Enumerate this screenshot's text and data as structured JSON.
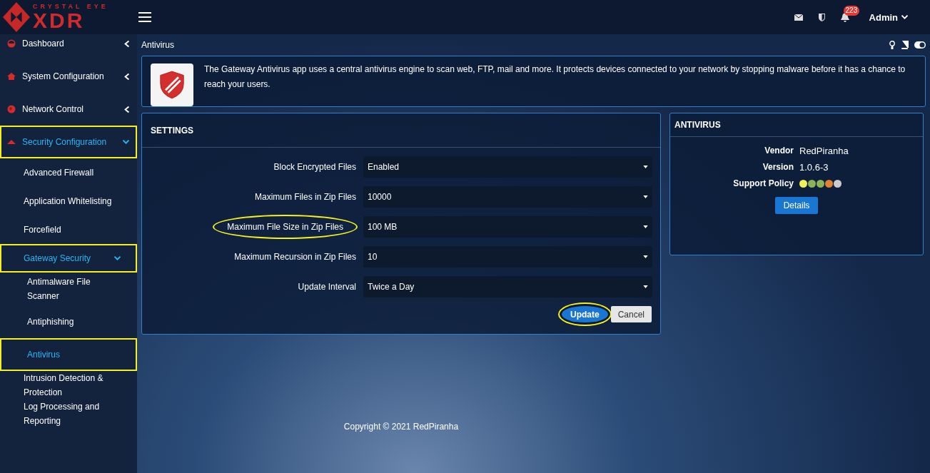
{
  "header": {
    "logo_small": "CRYSTAL EYE",
    "logo_big": "XDR",
    "notifications": "223",
    "user": "Admin"
  },
  "sidebar": {
    "items": [
      {
        "label": "Dashboard",
        "expanded": false,
        "selected": false,
        "highlighted": false
      },
      {
        "label": "System Configuration",
        "expanded": false,
        "selected": false,
        "highlighted": false
      },
      {
        "label": "Network Control",
        "expanded": false,
        "selected": false,
        "highlighted": false
      },
      {
        "label": "Security Configuration",
        "expanded": true,
        "selected": true,
        "highlighted": true,
        "children": [
          {
            "label": "Advanced Firewall",
            "selected": false,
            "highlighted": false
          },
          {
            "label": "Application Whitelisting",
            "selected": false,
            "highlighted": false
          },
          {
            "label": "Forcefield",
            "selected": false,
            "highlighted": false
          },
          {
            "label": "Gateway Security",
            "expanded": true,
            "selected": true,
            "highlighted": true,
            "children": [
              {
                "label": "Antimalware File Scanner",
                "selected": false,
                "highlighted": false
              },
              {
                "label": "Antiphishing",
                "selected": false,
                "highlighted": false
              },
              {
                "label": "Antivirus",
                "selected": true,
                "highlighted": true
              }
            ]
          },
          {
            "label": "Intrusion Detection & Protection",
            "selected": false,
            "highlighted": false
          },
          {
            "label": "Log Processing and Reporting",
            "selected": false,
            "highlighted": false
          }
        ]
      }
    ]
  },
  "page_title": "Antivirus",
  "intro": "The Gateway Antivirus app uses a central antivirus engine to scan web, FTP, mail and more. It protects devices connected to your network by stopping malware before it has a chance to reach your users.",
  "settings": {
    "title": "SETTINGS",
    "fields": [
      {
        "label": "Block Encrypted Files",
        "value": "Enabled",
        "highlighted": false
      },
      {
        "label": "Maximum Files in Zip Files",
        "value": "10000",
        "highlighted": false
      },
      {
        "label": "Maximum File Size in Zip Files",
        "value": "100 MB",
        "highlighted": true
      },
      {
        "label": "Maximum Recursion in Zip Files",
        "value": "10",
        "highlighted": false
      },
      {
        "label": "Update Interval",
        "value": "Twice a Day",
        "highlighted": false
      }
    ],
    "buttons": [
      {
        "label": "Update",
        "kind": "primary",
        "highlighted": true
      },
      {
        "label": "Cancel",
        "kind": "secondary",
        "highlighted": false
      }
    ]
  },
  "info": {
    "title": "ANTIVIRUS",
    "rows": [
      {
        "label": "Vendor",
        "value": "RedPiranha"
      },
      {
        "label": "Version",
        "value": "1.0.6-3"
      }
    ],
    "support_label": "Support Policy",
    "support_dots": [
      {
        "color": "#f2ef5c"
      },
      {
        "color": "#8db356"
      },
      {
        "color": "#8db356"
      },
      {
        "color": "#e0822f"
      },
      {
        "color": "#cccccc"
      }
    ],
    "button": "Details"
  },
  "footer": "Copyright © 2021 RedPiranha"
}
